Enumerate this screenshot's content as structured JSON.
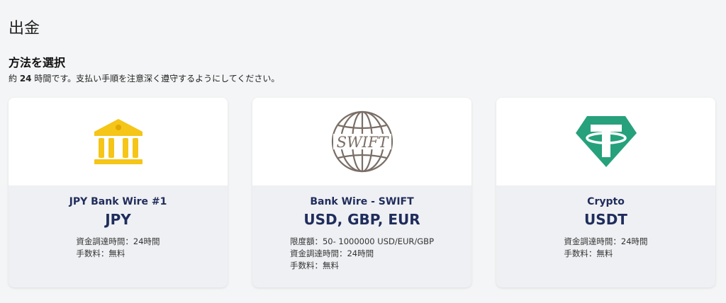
{
  "page": {
    "title": "出金"
  },
  "section": {
    "title": "方法を選択",
    "subtitle_prefix": "約 ",
    "subtitle_hours": "24",
    "subtitle_suffix": " 時間です。支払い手順を注意深く遵守するようにしてください。"
  },
  "methods": [
    {
      "icon": "bank-icon",
      "icon_color": "#f5c518",
      "name": "JPY Bank Wire #1",
      "currency": "JPY",
      "details": [
        "資金調達時間：24時間",
        "手数料：無料"
      ]
    },
    {
      "icon": "swift-logo-icon",
      "icon_color": "#7a6e66",
      "icon_text": "SWIFT",
      "name": "Bank Wire - SWIFT",
      "currency": "USD, GBP, EUR",
      "details": [
        "限度額：50- 1000000 USD/EUR/GBP",
        "資金調達時間：24時間",
        "手数料：無料"
      ]
    },
    {
      "icon": "tether-icon",
      "icon_color": "#26a17b",
      "name": "Crypto",
      "currency": "USDT",
      "details": [
        "資金調達時間：24時間",
        "手数料：無料"
      ]
    }
  ],
  "colors": {
    "background": "#f4f5f6",
    "card_body": "#eff0f3",
    "card_title": "#1f2d5c"
  }
}
